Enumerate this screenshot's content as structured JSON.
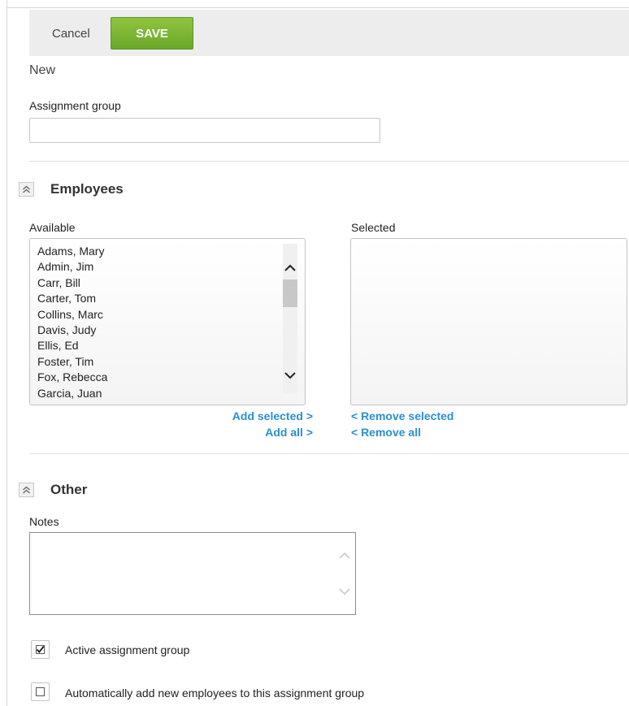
{
  "toolbar": {
    "cancel_label": "Cancel",
    "save_label": "SAVE"
  },
  "record": {
    "status": "New"
  },
  "assignment_group": {
    "label": "Assignment group",
    "value": ""
  },
  "employees_section": {
    "title": "Employees",
    "available_label": "Available",
    "selected_label": "Selected",
    "available": [
      "Adams, Mary",
      "Admin, Jim",
      "Carr, Bill",
      "Carter, Tom",
      "Collins, Marc",
      "Davis, Judy",
      "Ellis, Ed",
      "Foster, Tim",
      "Fox, Rebecca",
      "Garcia, Juan"
    ],
    "selected": [],
    "add_selected_label": "Add selected >",
    "add_all_label": "Add all >",
    "remove_selected_label": "< Remove selected",
    "remove_all_label": "< Remove all"
  },
  "other_section": {
    "title": "Other",
    "notes_label": "Notes",
    "notes_value": "",
    "active_label": "Active assignment group",
    "active_checked": true,
    "auto_add_label": "Automatically add new employees to this assignment group",
    "auto_add_checked": false
  },
  "colors": {
    "save_button": "#7ab833",
    "link": "#2a8fd0",
    "toolbar_bg": "#ededed"
  },
  "icons": {
    "collapse": "double-chevron-up-icon",
    "scroll_up": "chevron-up-icon",
    "scroll_down": "chevron-down-icon",
    "check": "checkmark-icon"
  }
}
